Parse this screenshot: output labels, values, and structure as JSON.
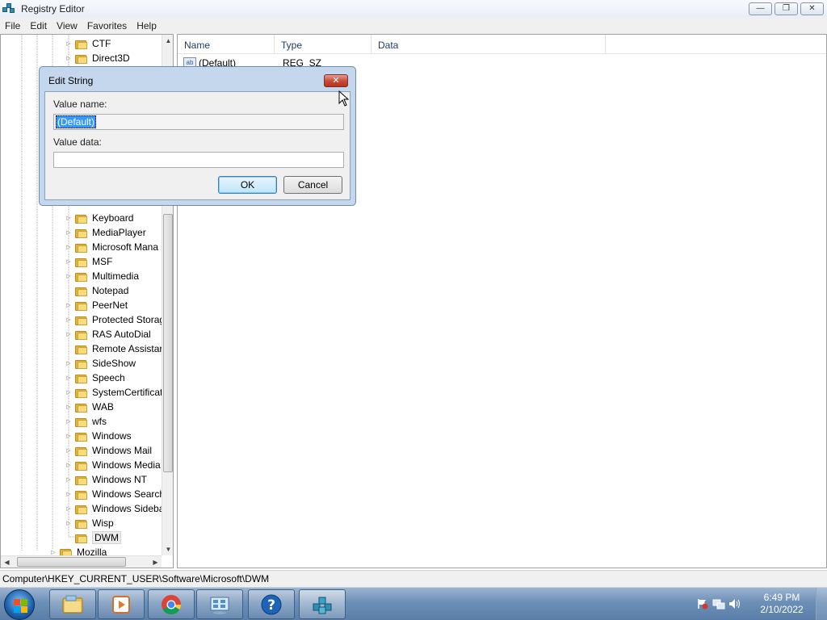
{
  "window": {
    "title": "Registry Editor",
    "controls": {
      "minimize": "—",
      "restore": "❐",
      "close": "✕"
    }
  },
  "menu": [
    "File",
    "Edit",
    "View",
    "Favorites",
    "Help"
  ],
  "tree": {
    "items": [
      {
        "label": "CTF",
        "expandable": true
      },
      {
        "label": "Direct3D",
        "expandable": true
      },
      {
        "label": "Keyboard",
        "expandable": true
      },
      {
        "label": "MediaPlayer",
        "expandable": true
      },
      {
        "label": "Microsoft Mana",
        "expandable": true
      },
      {
        "label": "MSF",
        "expandable": true
      },
      {
        "label": "Multimedia",
        "expandable": true
      },
      {
        "label": "Notepad",
        "expandable": false
      },
      {
        "label": "PeerNet",
        "expandable": true
      },
      {
        "label": "Protected Storag",
        "expandable": true
      },
      {
        "label": "RAS AutoDial",
        "expandable": true
      },
      {
        "label": "Remote Assistar",
        "expandable": false
      },
      {
        "label": "SideShow",
        "expandable": true
      },
      {
        "label": "Speech",
        "expandable": true
      },
      {
        "label": "SystemCertificat",
        "expandable": true
      },
      {
        "label": "WAB",
        "expandable": true
      },
      {
        "label": "wfs",
        "expandable": true
      },
      {
        "label": "Windows",
        "expandable": true
      },
      {
        "label": "Windows Mail",
        "expandable": true
      },
      {
        "label": "Windows Media",
        "expandable": true
      },
      {
        "label": "Windows NT",
        "expandable": true
      },
      {
        "label": "Windows Search",
        "expandable": true
      },
      {
        "label": "Windows Sideba",
        "expandable": true
      },
      {
        "label": "Wisp",
        "expandable": true
      },
      {
        "label": "DWM",
        "expandable": false,
        "selected": true
      },
      {
        "label": "Mozilla",
        "expandable": true
      }
    ]
  },
  "list": {
    "columns": [
      "Name",
      "Type",
      "Data"
    ],
    "rows": [
      {
        "icon": "ab",
        "name": "(Default)",
        "type": "REG_SZ",
        "data": ""
      }
    ]
  },
  "status": {
    "path": "Computer\\HKEY_CURRENT_USER\\Software\\Microsoft\\DWM"
  },
  "dialog": {
    "title": "Edit String",
    "close": "✕",
    "value_name_label": "Value name:",
    "value_name": "(Default)",
    "value_data_label": "Value data:",
    "value_data": "",
    "ok_label": "OK",
    "cancel_label": "Cancel"
  },
  "taskbar": {
    "apps": [
      {
        "name": "windows-explorer",
        "icon": "folder-library-icon"
      },
      {
        "name": "media-player",
        "icon": "media-player-icon"
      },
      {
        "name": "chrome",
        "icon": "chrome-icon"
      },
      {
        "name": "control-panel",
        "icon": "control-panel-icon"
      },
      {
        "name": "help",
        "icon": "help-icon"
      },
      {
        "name": "registry-editor",
        "icon": "registry-editor-icon",
        "active": true
      }
    ],
    "clock": {
      "time": "6:49 PM",
      "date": "2/10/2022"
    }
  },
  "colors": {
    "taskbar": "#6c8fb7",
    "dialog_frame": "#c5d7ec",
    "close_red": "#c94734",
    "selection": "#3399ff"
  }
}
